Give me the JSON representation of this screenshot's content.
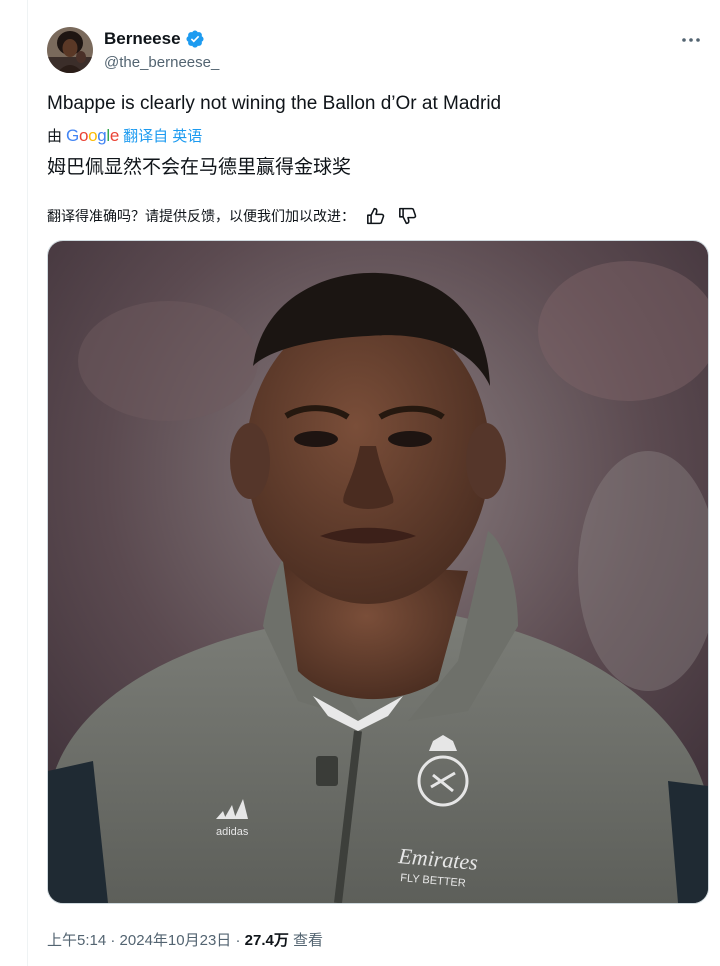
{
  "author": {
    "display_name": "Berneese",
    "handle": "@the_berneese_",
    "verified_color": "#1d9bf0"
  },
  "tweet": {
    "text": "Mbappe is clearly not wining the Ballon d’Or at Madrid",
    "translate_by_label": "由",
    "translate_provider": "Google",
    "translate_from_label": "翻译自 英语",
    "translated_text": "姆巴佩显然不会在马德里赢得金球奖",
    "feedback_prompt": "翻译得准确吗？请提供反馈，以便我们加以改进：",
    "media_icons": [
      "photo"
    ],
    "media_alt": ""
  },
  "meta": {
    "time": "上午5:14",
    "separator": " · ",
    "date": "2024年10月23日",
    "views_count": "27.4万",
    "views_label": " 查看"
  },
  "icons": {
    "more": "more-icon",
    "thumbs_up": "thumbs-up-icon",
    "thumbs_down": "thumbs-down-icon",
    "verified": "verified-badge-icon"
  }
}
